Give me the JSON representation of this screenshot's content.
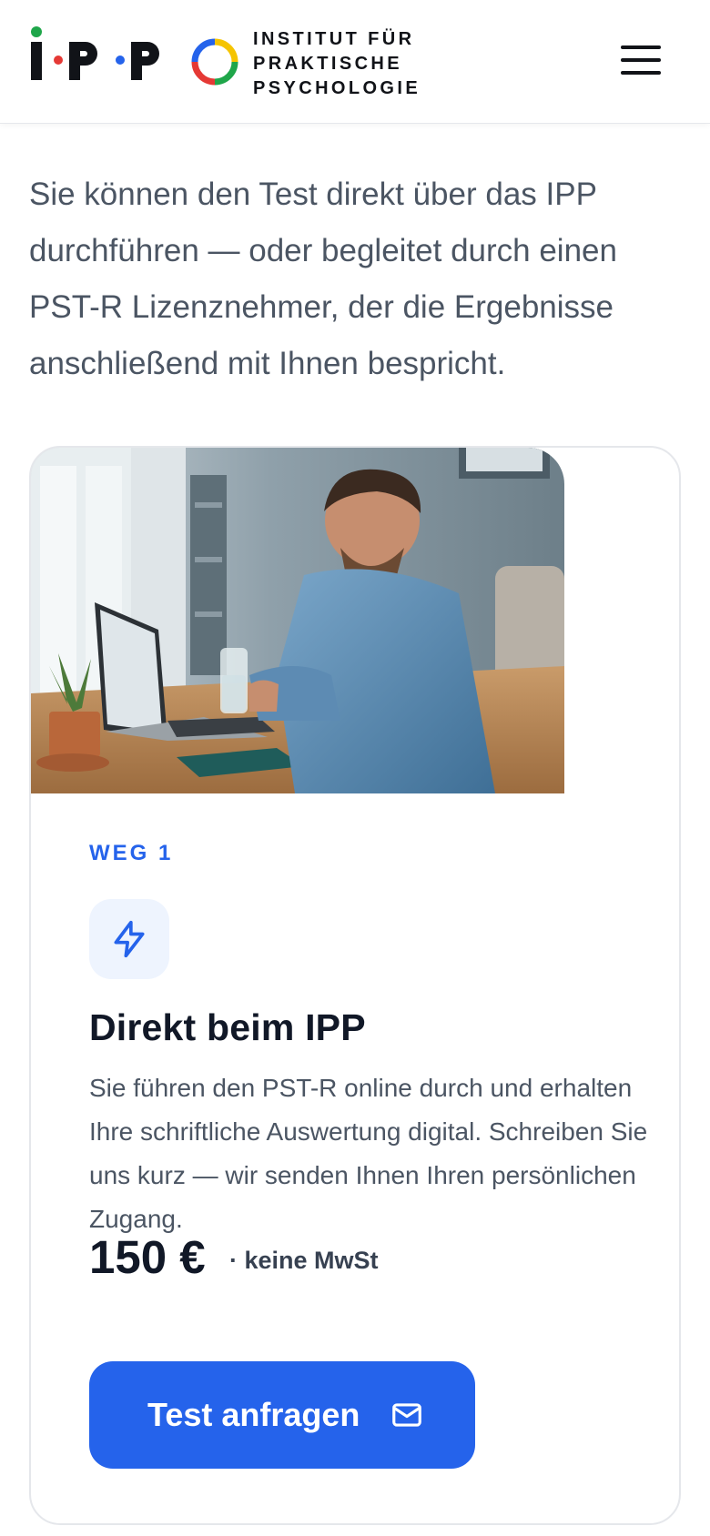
{
  "brand": {
    "mark_letters": [
      "I",
      "P",
      "P"
    ],
    "wordmark_lines": [
      "INSTITUT FÜR",
      "PRAKTISCHE",
      "PSYCHOLOGIE"
    ],
    "colors": {
      "green": "#1fa64a",
      "red": "#e53935",
      "blue": "#2563eb",
      "yellow": "#f5c400"
    }
  },
  "header": {
    "menu_icon": "hamburger-menu-icon"
  },
  "intro": {
    "text": "Sie können den Test direkt über das IPP durchführen — oder begleitet durch einen PST-R Lizenznehmer, der die Ergebnisse anschließend mit Ihnen bespricht."
  },
  "card": {
    "image_subject": "man working on laptop at wooden desk",
    "step_label": "WEG 1",
    "icon": "lightning-icon",
    "title": "Direkt beim IPP",
    "description": "Sie führen den PST-R online durch und erhalten Ihre schriftliche Auswertung digital. Schreiben Sie uns kurz — wir senden Ihnen Ihren persönlichen Zugang.",
    "price": "150 €",
    "vat_note": "· keine MwSt",
    "cta_label": "Test anfragen",
    "cta_icon": "mail-icon",
    "accent": "#2563eb"
  }
}
